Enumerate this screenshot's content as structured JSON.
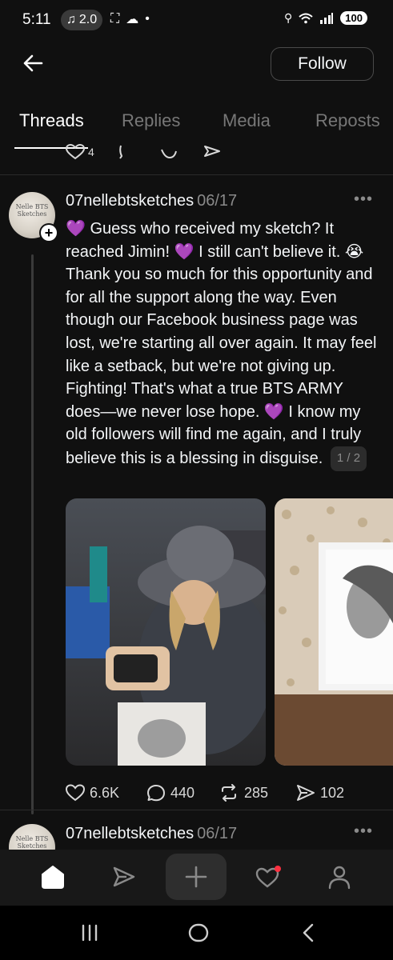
{
  "status_bar": {
    "time": "5:11",
    "music_badge": "2.0",
    "battery": "100"
  },
  "header": {
    "follow_label": "Follow"
  },
  "tabs": [
    {
      "label": "Threads",
      "active": true
    },
    {
      "label": "Replies",
      "active": false
    },
    {
      "label": "Media",
      "active": false
    },
    {
      "label": "Reposts",
      "active": false
    }
  ],
  "prev_post": {
    "like_count": "4"
  },
  "post": {
    "username": "07nellebtsketches",
    "date": "06/17",
    "avatar_text": "Nelle BTS Sketches",
    "text": "💜 Guess who received my sketch? It reached Jimin! 💜 I still can't believe it. 😭 Thank you so much for this opportunity and for all the support along the way. Even though our Facebook business page was lost, we're starting all over again. It may feel like a setback, but we're not giving up. Fighting! That's what a true BTS ARMY does—we never lose hope. 💜 I know my old followers will find me again, and I truly believe this is a blessing in disguise.",
    "page_indicator": "1 / 2",
    "likes": "6.6K",
    "replies": "440",
    "reposts": "285",
    "shares": "102"
  },
  "next_post": {
    "username": "07nellebtsketches",
    "date": "06/17"
  },
  "colors": {
    "background": "#101010",
    "accent_heart": "#a259ff",
    "notification_dot": "#ff3040"
  }
}
